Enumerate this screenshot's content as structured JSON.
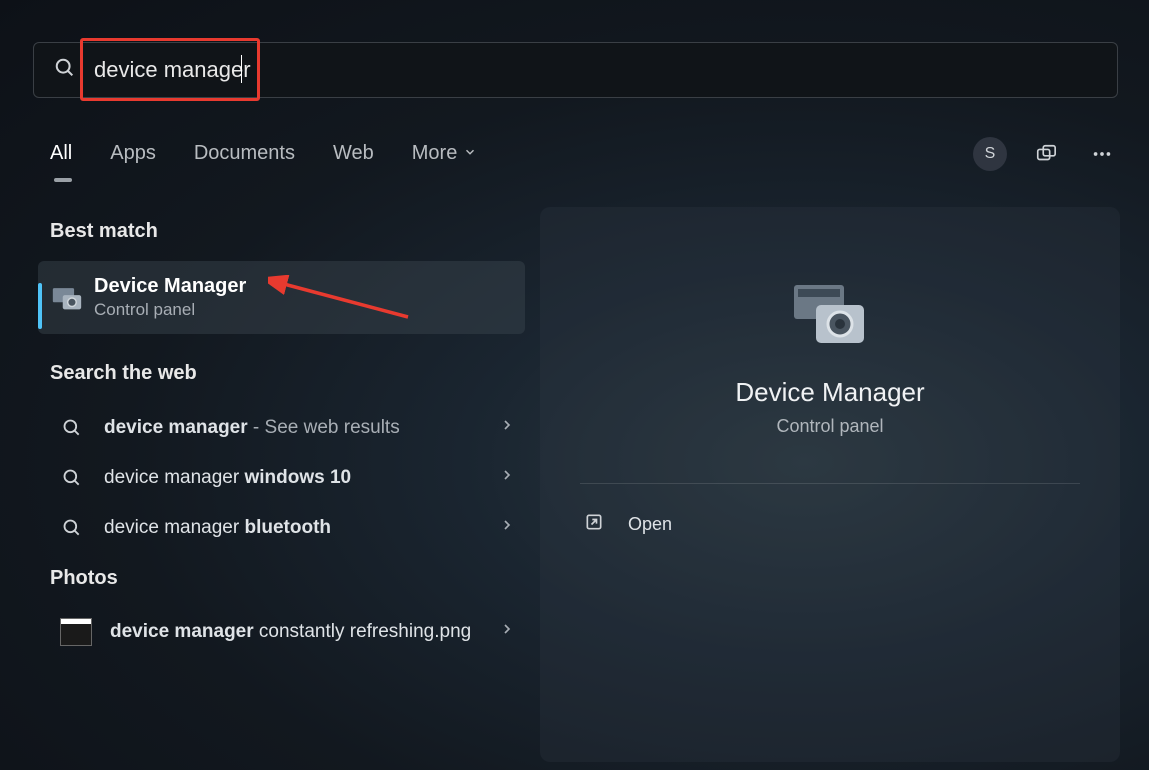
{
  "search": {
    "value": "device manager"
  },
  "tabs": {
    "all": "All",
    "apps": "Apps",
    "documents": "Documents",
    "web": "Web",
    "more": "More"
  },
  "avatar_initial": "S",
  "sections": {
    "best_match": "Best match",
    "search_web": "Search the web",
    "photos": "Photos"
  },
  "best_match": {
    "title": "Device Manager",
    "subtitle": "Control panel"
  },
  "web_results": [
    {
      "prefix": "device manager",
      "bold": "",
      "suffix": " - See web results"
    },
    {
      "prefix": "device manager ",
      "bold": "windows 10",
      "suffix": ""
    },
    {
      "prefix": "device manager ",
      "bold": "bluetooth",
      "suffix": ""
    }
  ],
  "photo_result": {
    "bold": "device manager",
    "rest": " constantly refreshing.png"
  },
  "preview": {
    "title": "Device Manager",
    "subtitle": "Control panel",
    "open": "Open"
  }
}
